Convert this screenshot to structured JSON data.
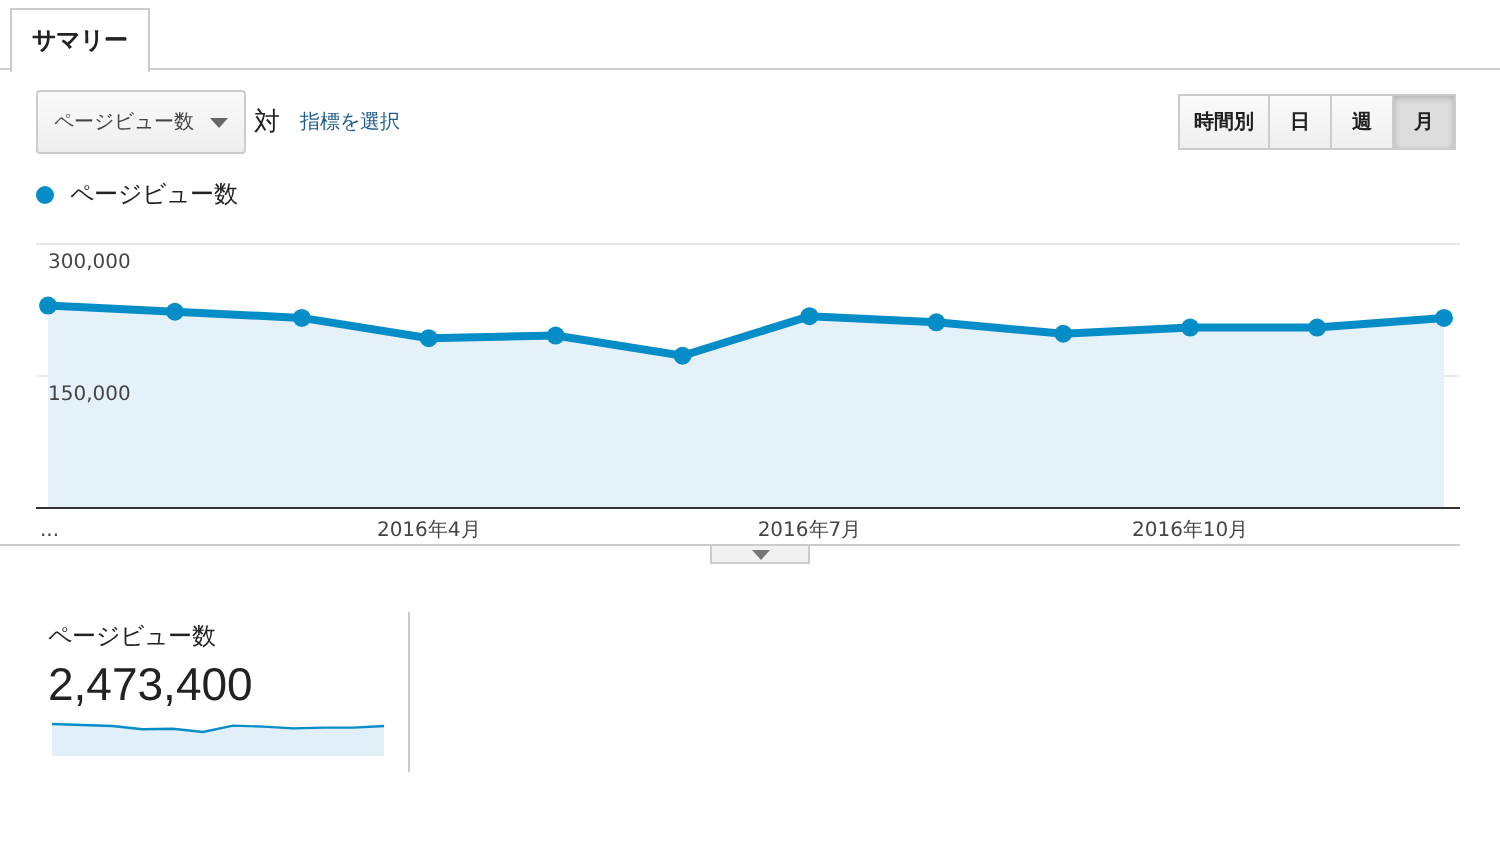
{
  "tabs": [
    {
      "label": "サマリー",
      "selected": true
    }
  ],
  "metric_select": {
    "value": "ページビュー数"
  },
  "versus_label": "対",
  "select_metric_link": "指標を選択",
  "period_buttons": [
    {
      "label": "時間別",
      "selected": false
    },
    {
      "label": "日",
      "selected": false
    },
    {
      "label": "週",
      "selected": false
    },
    {
      "label": "月",
      "selected": true
    }
  ],
  "chart_data": {
    "type": "area",
    "categories": [
      "...",
      null,
      null,
      "2016年4月",
      null,
      null,
      "2016年7月",
      null,
      null,
      "2016年10月",
      null,
      null
    ],
    "series": [
      {
        "name": "ページビュー数",
        "color": "#058dc7",
        "values": [
          230000,
          223000,
          216000,
          193000,
          196000,
          173000,
          218000,
          211000,
          198000,
          205000,
          205000,
          216000
        ]
      }
    ],
    "ylim": [
      0,
      300000
    ],
    "yticks": [
      {
        "value": 150000,
        "label": "150,000"
      },
      {
        "value": 300000,
        "label": "300,000"
      }
    ]
  },
  "scorecard": {
    "label": "ページビュー数",
    "value": "2,473,400"
  }
}
